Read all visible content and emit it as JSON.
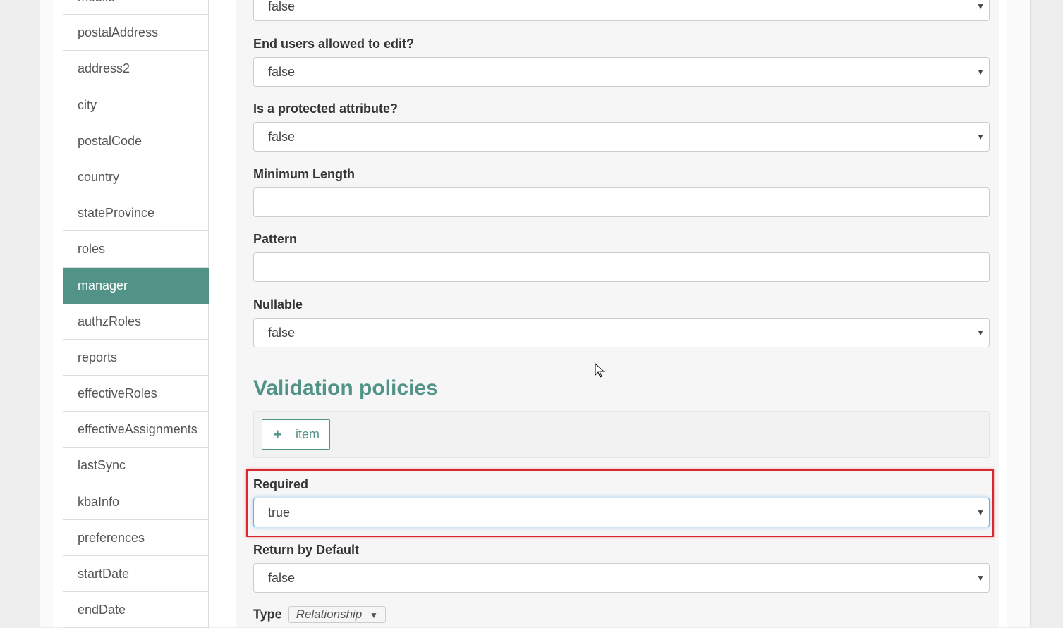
{
  "sidebar": {
    "items": [
      {
        "label": "mobile"
      },
      {
        "label": "postalAddress"
      },
      {
        "label": "address2"
      },
      {
        "label": "city"
      },
      {
        "label": "postalCode"
      },
      {
        "label": "country"
      },
      {
        "label": "stateProvince"
      },
      {
        "label": "roles"
      },
      {
        "label": "manager",
        "active": true
      },
      {
        "label": "authzRoles"
      },
      {
        "label": "reports"
      },
      {
        "label": "effectiveRoles"
      },
      {
        "label": "effectiveAssignments"
      },
      {
        "label": "lastSync"
      },
      {
        "label": "kbaInfo"
      },
      {
        "label": "preferences"
      },
      {
        "label": "startDate"
      },
      {
        "label": "endDate"
      }
    ]
  },
  "form": {
    "top_select_value": "false",
    "end_users_edit": {
      "label": "End users allowed to edit?",
      "value": "false"
    },
    "protected_attr": {
      "label": "Is a protected attribute?",
      "value": "false"
    },
    "min_length": {
      "label": "Minimum Length",
      "value": ""
    },
    "pattern": {
      "label": "Pattern",
      "value": ""
    },
    "nullable": {
      "label": "Nullable",
      "value": "false"
    },
    "validation": {
      "heading": "Validation policies",
      "add_label": "item"
    },
    "required": {
      "label": "Required",
      "value": "true"
    },
    "return_default": {
      "label": "Return by Default",
      "value": "false"
    },
    "type": {
      "label": "Type",
      "value": "Relationship"
    }
  },
  "colors": {
    "accent": "#519387",
    "highlight": "#d9272e",
    "focus": "#66afe9"
  }
}
